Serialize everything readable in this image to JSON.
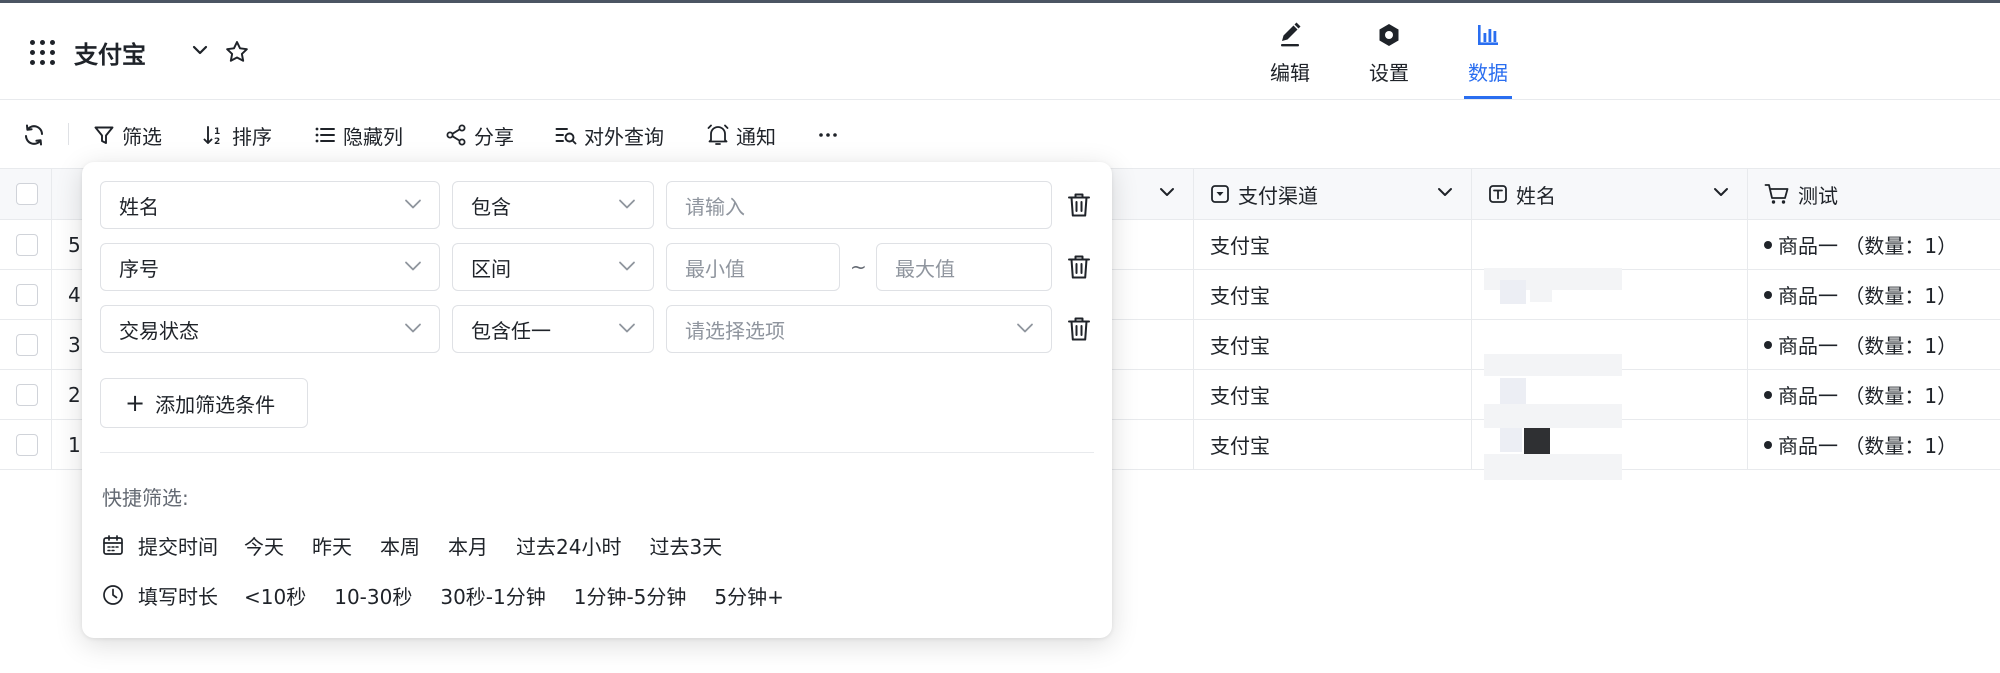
{
  "app": {
    "title": "支付宝"
  },
  "nav": {
    "tabs": [
      {
        "label": "编辑",
        "icon": "pencil-icon",
        "active": false
      },
      {
        "label": "设置",
        "icon": "gear-icon",
        "active": false
      },
      {
        "label": "数据",
        "icon": "bar-chart-icon",
        "active": true
      }
    ]
  },
  "toolbar": {
    "filter": "筛选",
    "sort": "排序",
    "hide_columns": "隐藏列",
    "share": "分享",
    "external_query": "对外查询",
    "notify": "通知"
  },
  "table": {
    "headers": {
      "channel": "支付渠道",
      "name": "姓名",
      "test": "测试"
    },
    "rows": [
      {
        "seq": "5",
        "channel": "支付宝",
        "goods": "商品一 （数量：1）"
      },
      {
        "seq": "4",
        "channel": "支付宝",
        "goods": "商品一 （数量：1）"
      },
      {
        "seq": "3",
        "channel": "支付宝",
        "goods": "商品一 （数量：1）"
      },
      {
        "seq": "2",
        "channel": "支付宝",
        "goods": "商品一 （数量：1）"
      },
      {
        "seq": "1",
        "channel": "支付宝",
        "goods": "商品一 （数量：1）"
      }
    ]
  },
  "filter_panel": {
    "conditions": [
      {
        "field": "姓名",
        "operator": "包含",
        "value_placeholder": "请输入"
      },
      {
        "field": "序号",
        "operator": "区间",
        "min_placeholder": "最小值",
        "separator": "~",
        "max_placeholder": "最大值"
      },
      {
        "field": "交易状态",
        "operator": "包含任一",
        "value_placeholder": "请选择选项"
      }
    ],
    "add_label": "添加筛选条件",
    "quick_title": "快捷筛选:",
    "quick_rows": [
      {
        "label": "提交时间",
        "icon": "calendar-icon",
        "options": [
          "今天",
          "昨天",
          "本周",
          "本月",
          "过去24小时",
          "过去3天"
        ]
      },
      {
        "label": "填写时长",
        "icon": "clock-icon",
        "options": [
          "<10秒",
          "10-30秒",
          "30秒-1分钟",
          "1分钟-5分钟",
          "5分钟+"
        ]
      }
    ]
  },
  "colors": {
    "accent": "#2a6ef0",
    "text": "#1f2329",
    "muted": "#8f959e"
  }
}
